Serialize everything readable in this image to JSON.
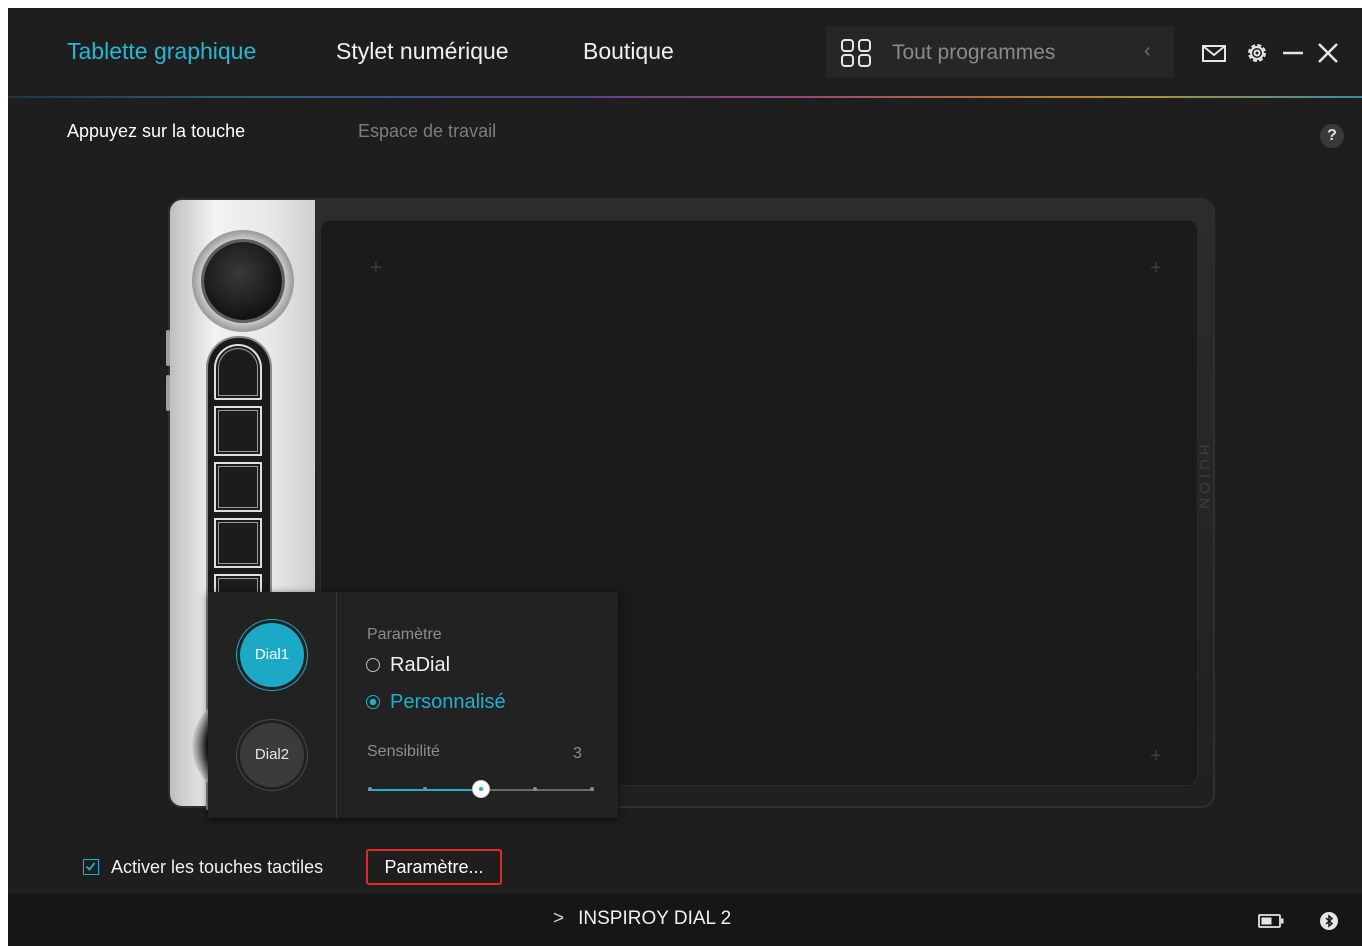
{
  "topnav": {
    "tabs": [
      {
        "label": "Tablette graphique",
        "active": true
      },
      {
        "label": "Stylet numérique",
        "active": false
      },
      {
        "label": "Boutique",
        "active": false
      }
    ],
    "programs_label": "Tout programmes",
    "programs_icon": "grid-icon",
    "back_icon": "chevron-left-icon",
    "window_icons": [
      "mail-icon",
      "gear-icon",
      "minimize-icon",
      "close-icon"
    ]
  },
  "subtabs": [
    {
      "label": "Appuyez sur la touche",
      "active": true
    },
    {
      "label": "Espace de travail",
      "active": false
    }
  ],
  "help_label": "?",
  "tablet": {
    "brand": "HUION"
  },
  "dial_popup": {
    "dials": [
      {
        "label": "Dial1",
        "selected": true
      },
      {
        "label": "Dial2",
        "selected": false
      }
    ],
    "section_label": "Paramètre",
    "options": [
      {
        "label": "RaDial",
        "selected": false
      },
      {
        "label": "Personnalisé",
        "selected": true
      }
    ],
    "sensitivity_label": "Sensibilité",
    "sensitivity_value": "3",
    "sensitivity_level": 3,
    "sensitivity_max": 5
  },
  "bottom": {
    "enable_touch_label": "Activer les touches tactiles",
    "enable_touch_checked": true,
    "settings_button_label": "Paramètre..."
  },
  "statusbar": {
    "device_name": "INSPIROY DIAL 2",
    "battery_icon": "battery-icon",
    "bluetooth_icon": "bluetooth-icon"
  },
  "colors": {
    "accent": "#1fb0cd",
    "highlight_border": "#e8262a",
    "background": "#1e1e1e"
  }
}
